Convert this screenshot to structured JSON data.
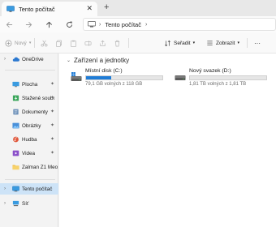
{
  "window": {
    "tab_title": "Tento počítač",
    "tab_close": "✕",
    "new_tab": "+"
  },
  "address_bar": {
    "separator": "›",
    "crumbs": [
      "Tento počítač",
      "›"
    ]
  },
  "command_bar": {
    "new_label": "Nový",
    "sort_label": "Seřadit",
    "view_label": "Zobrazit",
    "more_label": "···"
  },
  "sidebar": {
    "onedrive": "OneDrive",
    "quick_access": [
      {
        "label": "Plocha",
        "icon": "desktop-icon"
      },
      {
        "label": "Stažené soubory",
        "icon": "downloads-icon"
      },
      {
        "label": "Dokumenty",
        "icon": "documents-icon"
      },
      {
        "label": "Obrázky",
        "icon": "pictures-icon"
      },
      {
        "label": "Hudba",
        "icon": "music-icon"
      },
      {
        "label": "Videa",
        "icon": "videos-icon"
      },
      {
        "label": "Zalman Z1 Meo",
        "icon": "folder-icon"
      }
    ],
    "this_pc": "Tento počítač",
    "network": "Síť"
  },
  "main": {
    "group_title": "Zařízení a jednotky",
    "drives": [
      {
        "name": "Místní disk (C:)",
        "info": "79,1 GB volných z 118 GB",
        "used_fraction": 0.33,
        "fill_color": "#1f7cd6"
      },
      {
        "name": "Nový svazek (D:)",
        "info": "1,81 TB volných z 1,81 TB",
        "used_fraction": 0.0,
        "fill_color": "#1f7cd6"
      }
    ]
  },
  "colors": {
    "accent": "#1f7cd6",
    "selected_bg": "#cde3f7"
  }
}
